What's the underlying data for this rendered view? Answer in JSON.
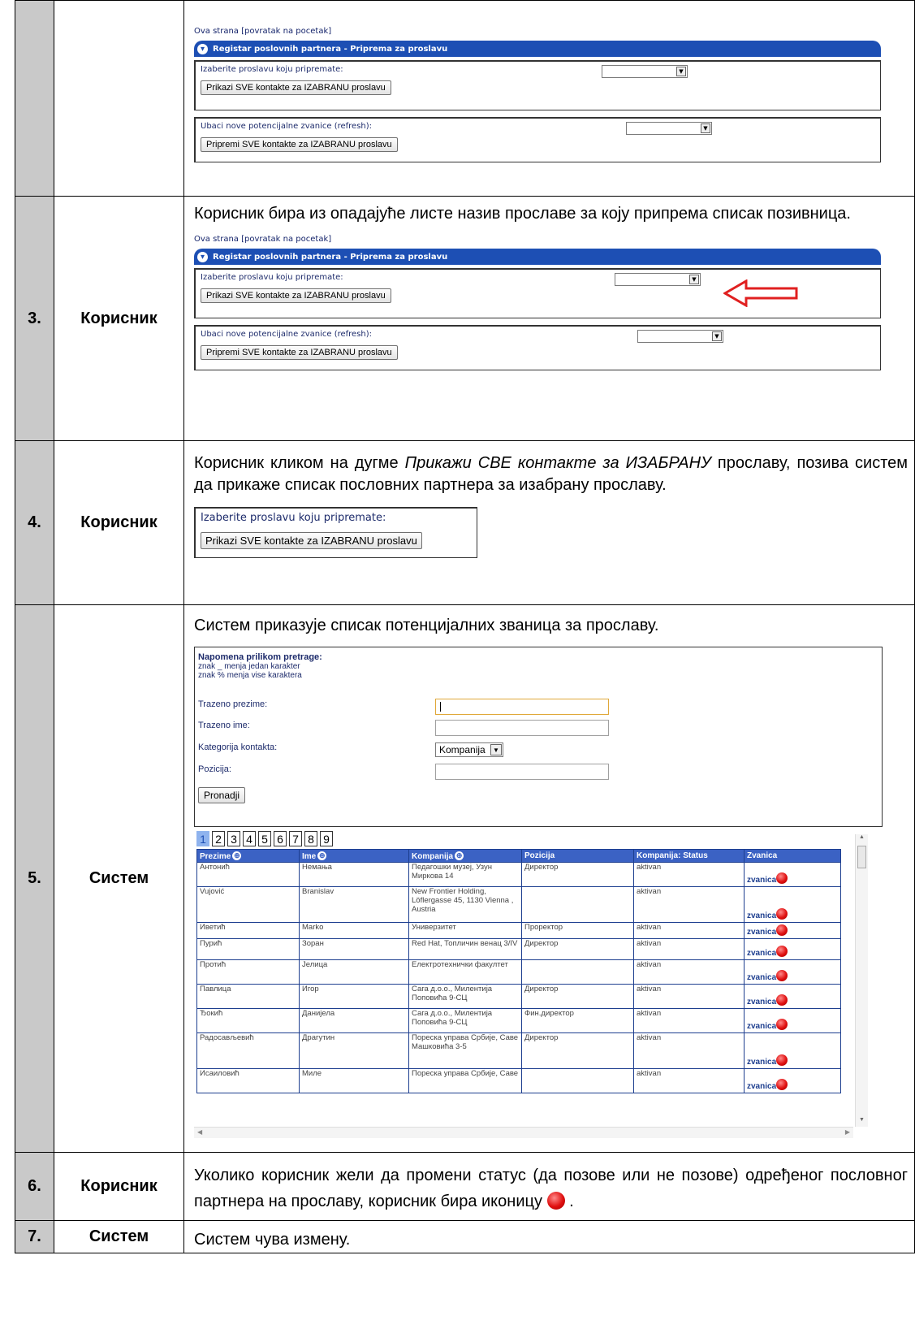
{
  "panel": {
    "link": "Ova strana [povratak na pocetak]",
    "title": "Registar poslovnih partnera - Priprema za proslavu",
    "label_select": "Izaberite proslavu koju pripremate:",
    "btn_show": "Prikazi SVE kontakte za IZABRANU proslavu",
    "label_refresh": "Ubaci nove potencijalne zvanice (refresh):",
    "btn_prepare": "Pripremi SVE kontakte za IZABRANU proslavu"
  },
  "rows": [
    {
      "num": "",
      "actor": ""
    },
    {
      "num": "3.",
      "actor": "Корисник",
      "text": "Корисник бира из опадајуће листе назив прославе за коју припрема списак позивница."
    },
    {
      "num": "4.",
      "actor": "Корисник",
      "text_a": "Корисник кликом на дугме ",
      "text_italic": "Прикажи СВЕ контакте за ИЗАБРАНУ",
      "text_b": " прославу, позива систем да прикаже списак пословних партнера за изабрану прославу."
    },
    {
      "num": "5.",
      "actor": "Систем",
      "text": "Систем приказује списак потенцијалних званица за прославу."
    },
    {
      "num": "6.",
      "actor": "Корисник",
      "text": "Уколико корисник жели да промени статус (да позове или не позове) одређеног пословног партнера на прославу, корисник бира иконицу"
    },
    {
      "num": "7.",
      "actor": "Систем",
      "text": "Систем чува измену."
    }
  ],
  "search": {
    "note_title": "Napomena prilikom pretrage:",
    "note_1": "znak _ menja jedan karakter",
    "note_2": "znak % menja vise karaktera",
    "label_surname": "Trazeno prezime:",
    "label_name": "Trazeno ime:",
    "label_category": "Kategorija kontakta:",
    "category_value": "Kompanija",
    "label_position": "Pozicija:",
    "btn_find": "Pronadji"
  },
  "pages": [
    "1",
    "2",
    "3",
    "4",
    "5",
    "6",
    "7",
    "8",
    "9"
  ],
  "grid": {
    "headers": [
      "Prezime",
      "Ime",
      "Kompanija",
      "Pozicija",
      "Kompanija: Status",
      "Zvanica"
    ],
    "zvanica_label": "zvanica",
    "rows": [
      {
        "surname": "Антонић",
        "name": "Немања",
        "company": "Педагошки музеј, Узун Миркова 14",
        "position": "Директор",
        "status": "aktivan"
      },
      {
        "surname": "Vujović",
        "name": "Branislav",
        "company": "New Frontier Holding, Löflergasse 45, 1130 Vienna , Austria",
        "position": "",
        "status": "aktivan"
      },
      {
        "surname": "Иветић",
        "name": "Marko",
        "company": "Универзитет",
        "position": "Проректор",
        "status": "aktivan"
      },
      {
        "surname": "Пурић",
        "name": "Зоран",
        "company": "Red Hat, Топличин венац 3/IV",
        "position": "Директор",
        "status": "aktivan"
      },
      {
        "surname": "Протић",
        "name": "Јелица",
        "company": "Електротехнички факултет",
        "position": "",
        "status": "aktivan"
      },
      {
        "surname": "Павлица",
        "name": "Игор",
        "company": "Сага д.о.о., Милентија Поповића 9-СЦ",
        "position": "Директор",
        "status": "aktivan"
      },
      {
        "surname": "Ђокић",
        "name": "Данијела",
        "company": "Сага д.о.о., Милентија Поповића 9-СЦ",
        "position": "Фин.директор",
        "status": "aktivan"
      },
      {
        "surname": "Радосављевић",
        "name": "Драгутин",
        "company": "Пореска управа Србије, Саве Машковића 3-5",
        "position": "Директор",
        "status": "aktivan"
      },
      {
        "surname": "Исаиловић",
        "name": "Миле",
        "company": "Пореска управа Србије, Саве",
        "position": "",
        "status": "aktivan"
      }
    ]
  },
  "colors": {
    "accent": "#1d4fb4",
    "header": "#3b62c4",
    "arrow": "#e02020",
    "num_bg": "#c9c9c9"
  }
}
